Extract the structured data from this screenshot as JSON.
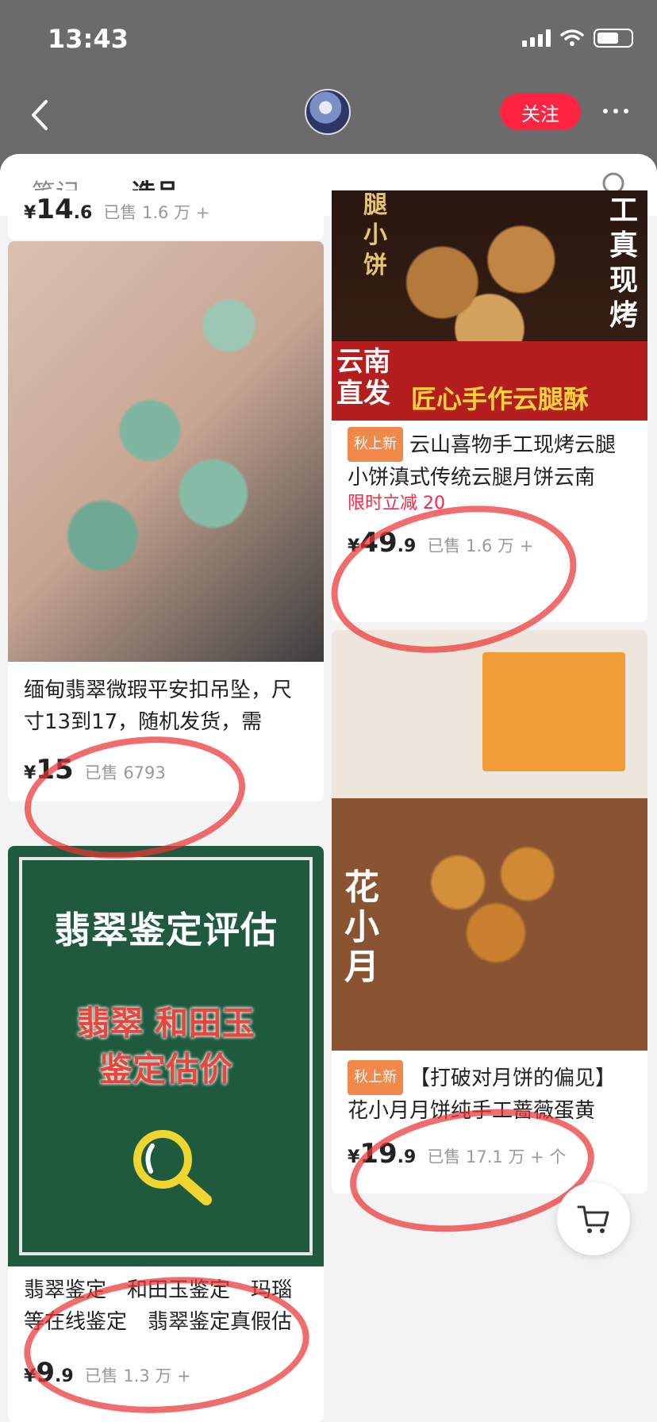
{
  "status": {
    "time": "13:43"
  },
  "header": {
    "follow_label": "关注"
  },
  "tabs": [
    {
      "label": "笔记",
      "active": false
    },
    {
      "label": "选品",
      "active": true
    }
  ],
  "left_column": [
    {
      "price_currency": "¥",
      "price_int": "14",
      "price_dec": ".6",
      "sold": "已售 1.6 万 +"
    },
    {
      "title": "缅甸翡翠微瑕平安扣吊坠，尺寸13到17，随机发货，需",
      "price_currency": "¥",
      "price_int": "15",
      "price_dec": "",
      "sold": "已售 6793"
    },
    {
      "image_title": "翡翠鉴定评估",
      "image_sub1": "翡翠 和田玉",
      "image_sub2": "鉴定估价",
      "title": "翡翠鉴定　和田玉鉴定　玛瑙等在线鉴定　翡翠鉴定真假估",
      "price_currency": "¥",
      "price_int": "9",
      "price_dec": ".9",
      "sold": "已售 1.3 万 +"
    }
  ],
  "right_column": [
    {
      "image_left": "云南直发",
      "image_right": "匠心手作云腿酥",
      "image_vert": "工真现烤",
      "image_topleft": "腿小饼",
      "tag": "秋上新",
      "title": "云山喜物手工现烤云腿小饼滇式传统云腿月饼云南",
      "promo": "限时立减 20",
      "price_currency": "¥",
      "price_int": "49",
      "price_dec": ".9",
      "sold": "已售 1.6 万 +"
    },
    {
      "image_vert": "花小月",
      "tag": "秋上新",
      "title": "【打破对月饼的偏见】花小月月饼纯手工蔷薇蛋黄",
      "price_currency": "¥",
      "price_int": "19",
      "price_dec": ".9",
      "sold": "已售 17.1 万 + 个"
    }
  ],
  "colors": {
    "accent": "#ff2442",
    "annotation": "#eb3434",
    "tag": "#f0894a"
  }
}
